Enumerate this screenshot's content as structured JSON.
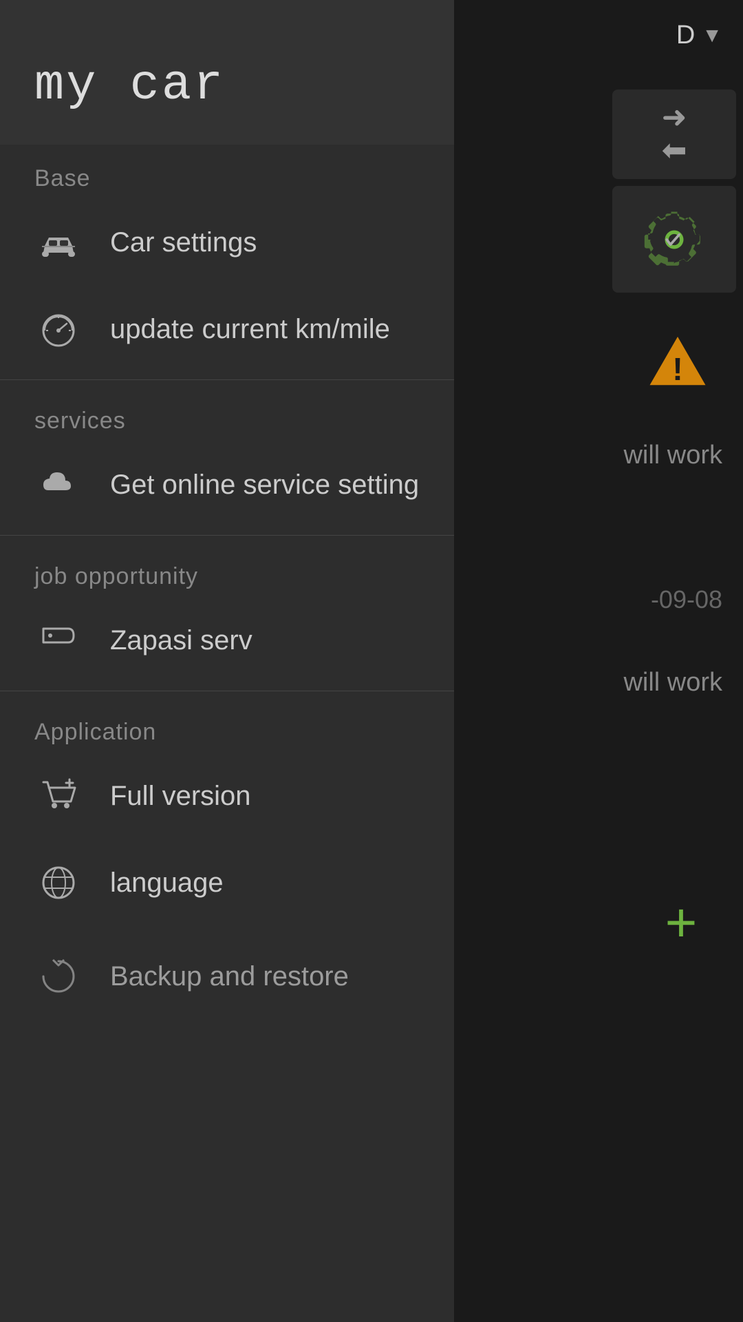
{
  "app": {
    "title": "my car"
  },
  "right_panel": {
    "dropdown_label": "D",
    "date_text": "-09-08",
    "will_work_text_1": "will work",
    "will_work_text_2": "will work"
  },
  "drawer": {
    "sections": [
      {
        "id": "base",
        "label": "Base",
        "items": [
          {
            "id": "car-settings",
            "label": "Car settings",
            "icon": "car-icon"
          },
          {
            "id": "update-km",
            "label": "update current km/mile",
            "icon": "speedometer-icon"
          }
        ]
      },
      {
        "id": "services",
        "label": "services",
        "items": [
          {
            "id": "online-service",
            "label": "Get online service setting",
            "icon": "download-cloud-icon"
          }
        ]
      },
      {
        "id": "job-opportunity",
        "label": "job opportunity",
        "items": [
          {
            "id": "zapasi-serv",
            "label": "Zapasi serv",
            "icon": "tag-icon"
          }
        ]
      },
      {
        "id": "application",
        "label": "Application",
        "items": [
          {
            "id": "full-version",
            "label": "Full version",
            "icon": "cart-plus-icon"
          },
          {
            "id": "language",
            "label": "language",
            "icon": "globe-icon"
          },
          {
            "id": "backup-restore",
            "label": "Backup and restore",
            "icon": "backup-icon"
          }
        ]
      }
    ]
  }
}
